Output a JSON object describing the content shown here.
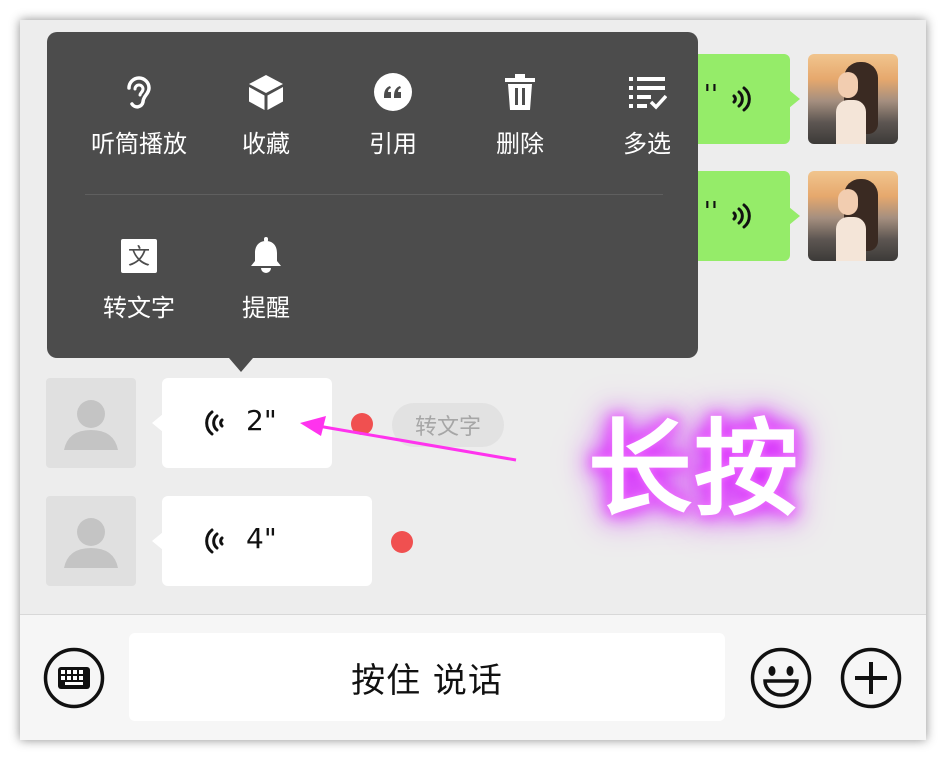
{
  "context_menu": {
    "items": [
      {
        "label": "听筒播放",
        "icon": "ear-icon"
      },
      {
        "label": "收藏",
        "icon": "cube-icon"
      },
      {
        "label": "引用",
        "icon": "quote-icon"
      },
      {
        "label": "删除",
        "icon": "trash-icon"
      },
      {
        "label": "多选",
        "icon": "multi-select-icon"
      },
      {
        "label": "转文字",
        "icon": "text-convert-icon"
      },
      {
        "label": "提醒",
        "icon": "bell-icon"
      }
    ],
    "text_icon_glyph": "文",
    "quote_glyph": "“"
  },
  "messages": {
    "self": [
      {
        "duration": "''"
      },
      {
        "duration": "''"
      }
    ],
    "other": [
      {
        "duration": "2\"",
        "unread": true
      },
      {
        "duration": "4\"",
        "unread": true
      }
    ],
    "transcribe_button": "转文字"
  },
  "annotation": {
    "text": "长按",
    "color": "#ff33ee"
  },
  "input_bar": {
    "hold_to_talk": "按住 说话",
    "keyboard_icon": "keyboard-icon",
    "emoji_icon": "emoji-icon",
    "plus_icon": "plus-icon"
  },
  "colors": {
    "self_bubble": "#95ec69",
    "menu_bg": "#4c4c4c",
    "unread_dot": "#f05050",
    "chat_bg": "#ededed"
  }
}
